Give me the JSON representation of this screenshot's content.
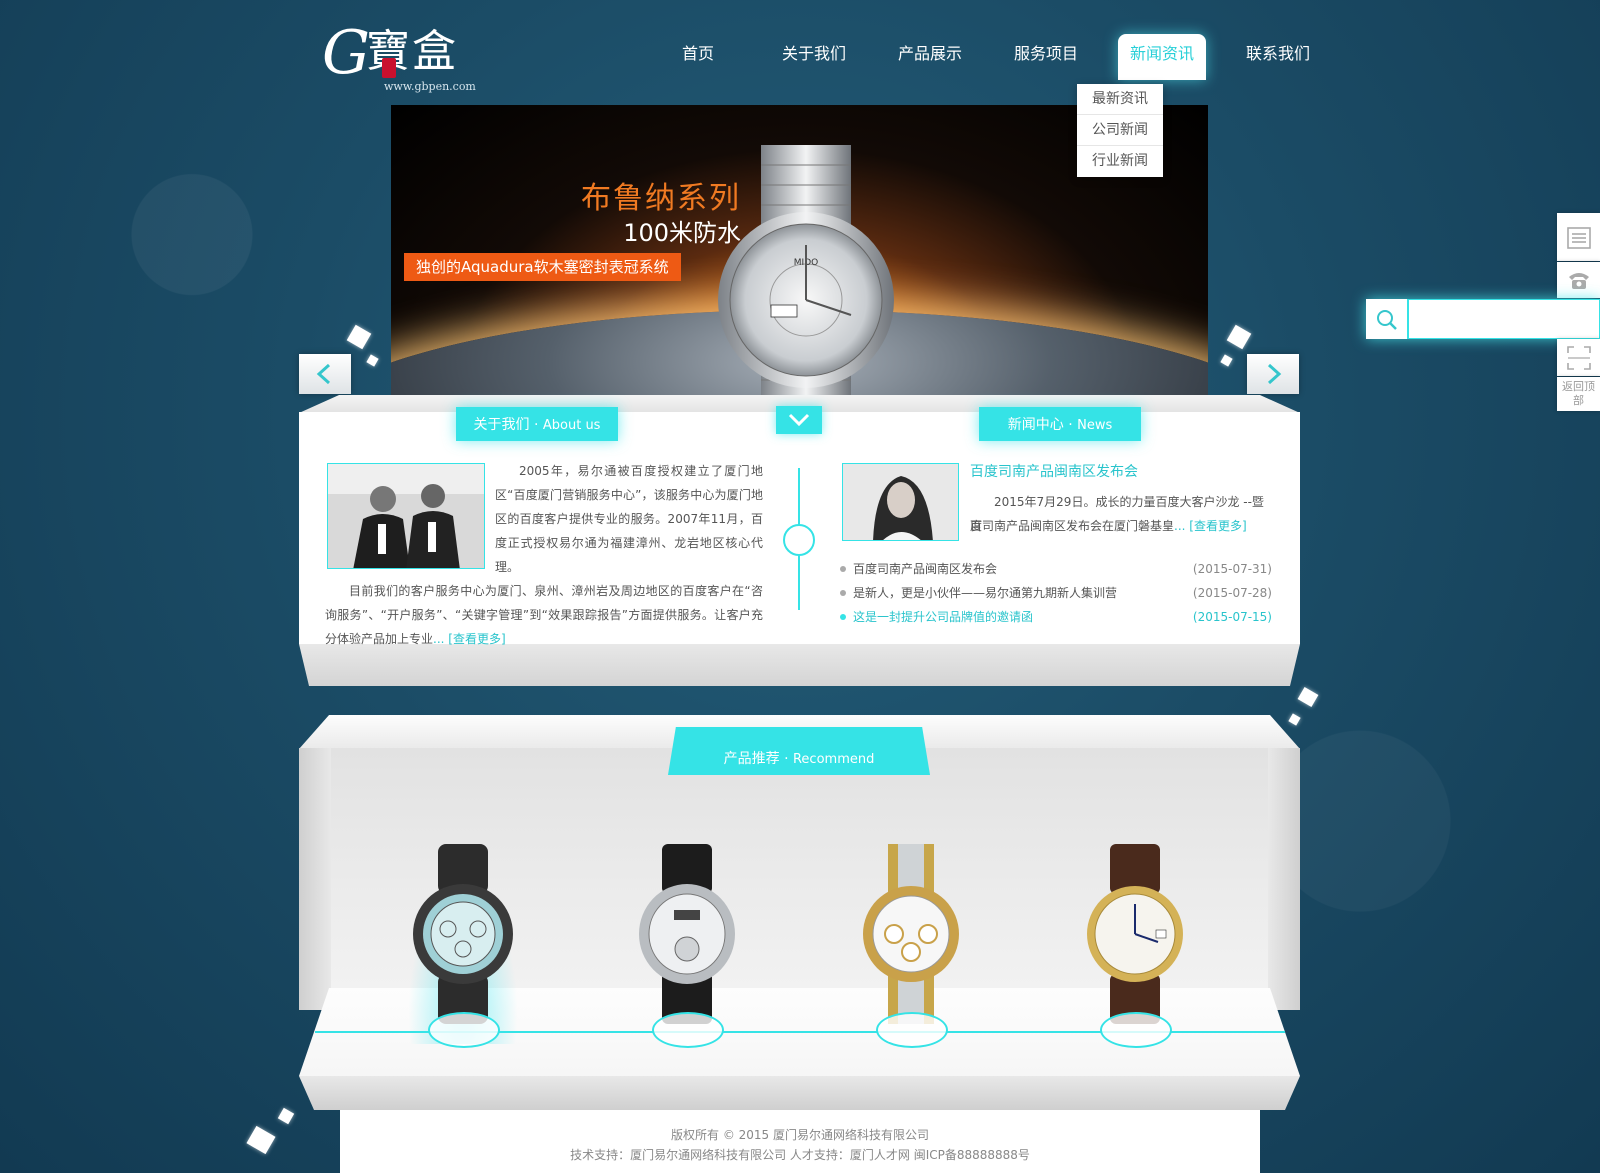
{
  "brand": {
    "logo_letter": "G",
    "logo_text": "寶盒",
    "url": "www.gbpen.com"
  },
  "nav": {
    "items": [
      {
        "label": "首页"
      },
      {
        "label": "关于我们"
      },
      {
        "label": "产品展示"
      },
      {
        "label": "服务项目"
      },
      {
        "label": "新闻资讯",
        "active": true
      },
      {
        "label": "联系我们"
      }
    ],
    "dropdown": [
      "最新资讯",
      "公司新闻",
      "行业新闻"
    ]
  },
  "banner": {
    "title1": "布鲁纳系列",
    "title2": "100米防水",
    "tag": "独创的Aquadura软木塞密封表冠系统",
    "watch_brand": "MIDO"
  },
  "about": {
    "tab_cn": "关于我们 · ",
    "tab_en": "About us",
    "para1": "2005年，易尔通被百度授权建立了厦门地区“百度厦门营销服务中心”，该服务中心为厦门地区的百度客户提供专业的服务。2007年11月，百度正式授权易尔通为福建漳州、龙岩地区核心代理。",
    "para2": "目前我们的客户服务中心为厦门、泉州、漳州岩及周边地区的百度客户在“咨询服务”、“开户服务”、“关键字管理”到“效果跟踪报告”方面提供服务。让客户充分体验产品加上专业",
    "ellipsis": "...",
    "more": "[查看更多]"
  },
  "news": {
    "tab_cn": "新闻中心 · ",
    "tab_en": "News",
    "headline": "百度司南产品闽南区发布会",
    "summary1": "2015年7月29日。成长的力量百度大客户沙龙 --暨百",
    "summary2": "度司南产品闽南区发布会在厦门磐基皇",
    "ellipsis": "...",
    "more": "[查看更多]",
    "list": [
      {
        "title": "百度司南产品闽南区发布会",
        "date": "(2015-07-31)"
      },
      {
        "title": "是新人，更是小伙伴——易尔通第九期新人集训营",
        "date": "(2015-07-28)"
      },
      {
        "title": "这是一封提升公司品牌值的邀请函",
        "date": "(2015-07-15)",
        "highlight": true
      }
    ]
  },
  "products": {
    "tab_cn": "产品推荐 · ",
    "tab_en": "Recommend",
    "items": [
      "chronograph-rubber-strap",
      "leather-dress-watch",
      "two-tone-daytona",
      "gold-leather-classic"
    ]
  },
  "footer": {
    "line1": "版权所有 © 2015 厦门易尔通网络科技有限公司",
    "line2": "技术支持：厦门易尔通网络科技有限公司 人才支持：厦门人才网 闽ICP备88888888号"
  },
  "sidebar": {
    "search_placeholder": "",
    "back_top": "返回顶部"
  },
  "colors": {
    "accent": "#35e3e6",
    "banner_orange": "#ee5a14",
    "bg": "#1b4c66"
  }
}
